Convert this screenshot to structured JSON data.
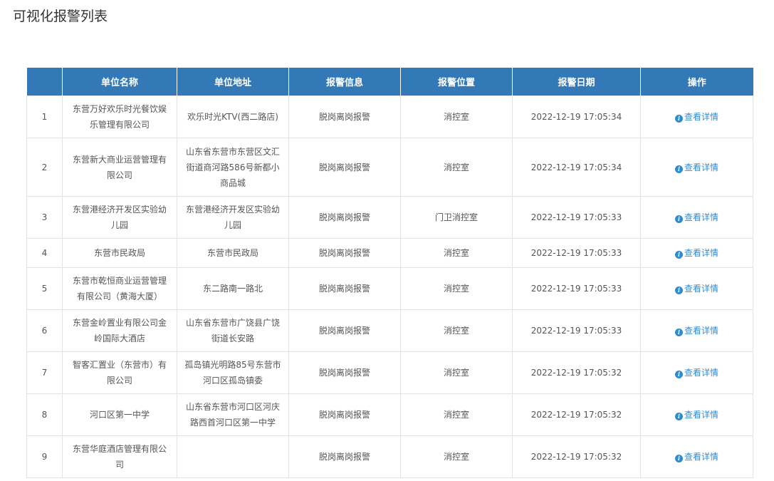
{
  "page": {
    "title": "可视化报警列表"
  },
  "colors": {
    "header_bg": "#3479b7",
    "link": "#2f8ccd"
  },
  "table": {
    "columns": [
      "",
      "单位名称",
      "单位地址",
      "报警信息",
      "报警位置",
      "报警日期",
      "操作"
    ],
    "action_label": "查看详情",
    "action_icon": "info-icon",
    "rows": [
      {
        "index": "1",
        "unit_name": "东营万好欢乐时光餐饮娱乐管理有限公司",
        "address": "欢乐时光KTV(西二路店)",
        "alarm_info": "脱岗离岗报警",
        "location": "消控室",
        "date": "2022-12-19 17:05:34"
      },
      {
        "index": "2",
        "unit_name": "东营新大商业运营管理有限公司",
        "address": "山东省东营市东营区文汇街道商河路586号新都小商品城",
        "alarm_info": "脱岗离岗报警",
        "location": "消控室",
        "date": "2022-12-19 17:05:34"
      },
      {
        "index": "3",
        "unit_name": "东营港经济开发区实验幼儿园",
        "address": "东营港经济开发区实验幼儿园",
        "alarm_info": "脱岗离岗报警",
        "location": "门卫消控室",
        "date": "2022-12-19 17:05:33"
      },
      {
        "index": "4",
        "unit_name": "东营市民政局",
        "address": "东营市民政局",
        "alarm_info": "脱岗离岗报警",
        "location": "消控室",
        "date": "2022-12-19 17:05:33"
      },
      {
        "index": "5",
        "unit_name": "东营市乾恒商业运营管理有限公司（黄海大厦）",
        "address": "东二路南一路北",
        "alarm_info": "脱岗离岗报警",
        "location": "消控室",
        "date": "2022-12-19 17:05:33"
      },
      {
        "index": "6",
        "unit_name": "东营金岭置业有限公司金岭国际大酒店",
        "address": "山东省东营市广饶县广饶街道长安路",
        "alarm_info": "脱岗离岗报警",
        "location": "消控室",
        "date": "2022-12-19 17:05:33"
      },
      {
        "index": "7",
        "unit_name": "智客汇置业（东营市）有限公司",
        "address": "孤岛镇光明路85号东营市河口区孤岛镇委",
        "alarm_info": "脱岗离岗报警",
        "location": "消控室",
        "date": "2022-12-19 17:05:32"
      },
      {
        "index": "8",
        "unit_name": "河口区第一中学",
        "address": "山东省东营市河口区河庆路西首河口区第一中学",
        "alarm_info": "脱岗离岗报警",
        "location": "消控室",
        "date": "2022-12-19 17:05:32"
      },
      {
        "index": "9",
        "unit_name": "东营华庭酒店管理有限公司",
        "address": "",
        "alarm_info": "脱岗离岗报警",
        "location": "消控室",
        "date": "2022-12-19 17:05:32"
      }
    ]
  }
}
